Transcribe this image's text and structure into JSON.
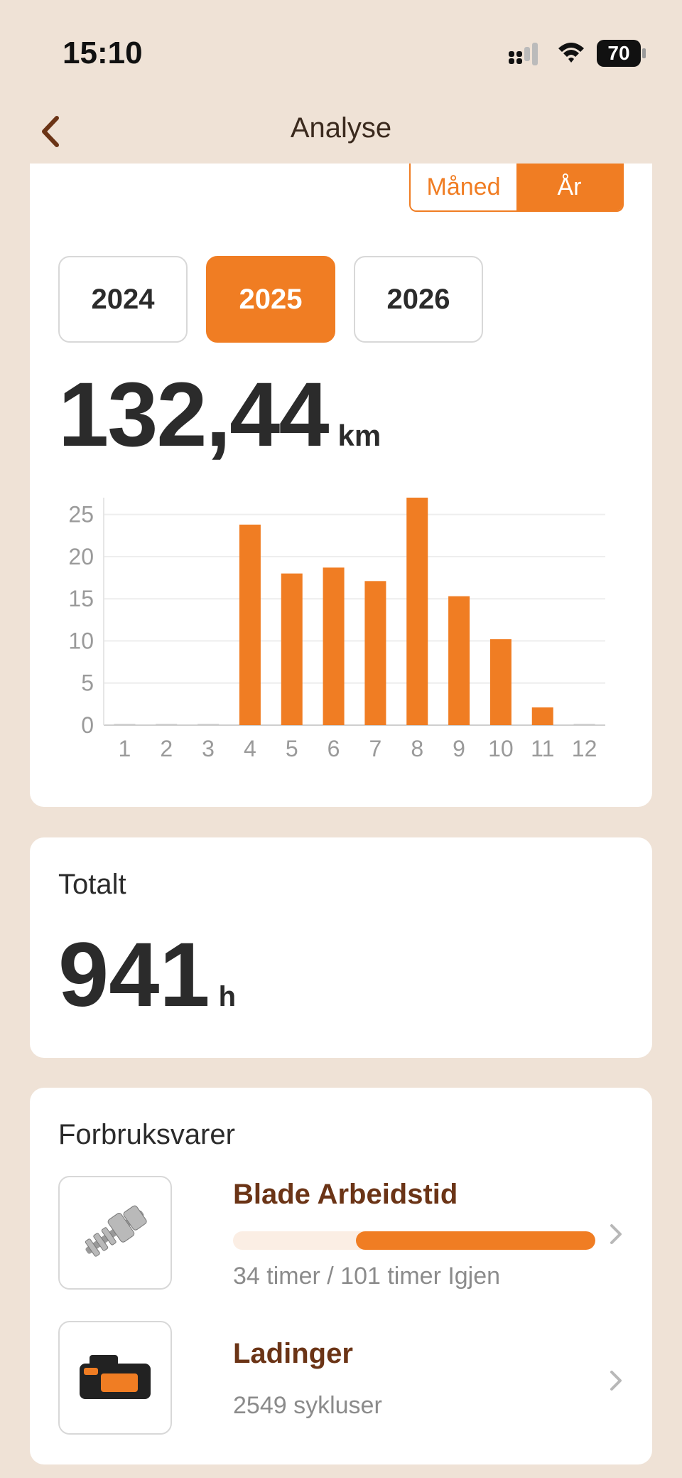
{
  "status": {
    "time": "15:10",
    "battery": "70"
  },
  "nav": {
    "title": "Analyse"
  },
  "period_toggle": {
    "month": "Måned",
    "year": "År",
    "selected": "year"
  },
  "years": [
    {
      "label": "2024",
      "active": false
    },
    {
      "label": "2025",
      "active": true
    },
    {
      "label": "2026",
      "active": false
    }
  ],
  "distance": {
    "value": "132,44",
    "unit": "km"
  },
  "chart_data": {
    "type": "bar",
    "categories": [
      "1",
      "2",
      "3",
      "4",
      "5",
      "6",
      "7",
      "8",
      "9",
      "10",
      "11",
      "12"
    ],
    "values": [
      0,
      0,
      0,
      23.8,
      18,
      18.7,
      17.1,
      27,
      15.3,
      10.2,
      2.1,
      0
    ],
    "yticks": [
      0,
      5,
      10,
      15,
      20,
      25
    ],
    "ylim": [
      0,
      27
    ],
    "color": "#f07d23",
    "grid": true
  },
  "total": {
    "label": "Totalt",
    "value": "941",
    "unit": "h"
  },
  "consumables": {
    "title": "Forbruksvarer",
    "items": [
      {
        "name": "Blade Arbeidstid",
        "detail": "34 timer / 101 timer Igjen",
        "progress": 0.66,
        "icon": "hedge-trimmer-blade-icon"
      },
      {
        "name": "Ladinger",
        "detail": "2549 sykluser",
        "icon": "battery-pack-icon"
      }
    ]
  },
  "colors": {
    "accent": "#f07d23",
    "background": "#efe2d6",
    "title_brown": "#6b3416"
  }
}
